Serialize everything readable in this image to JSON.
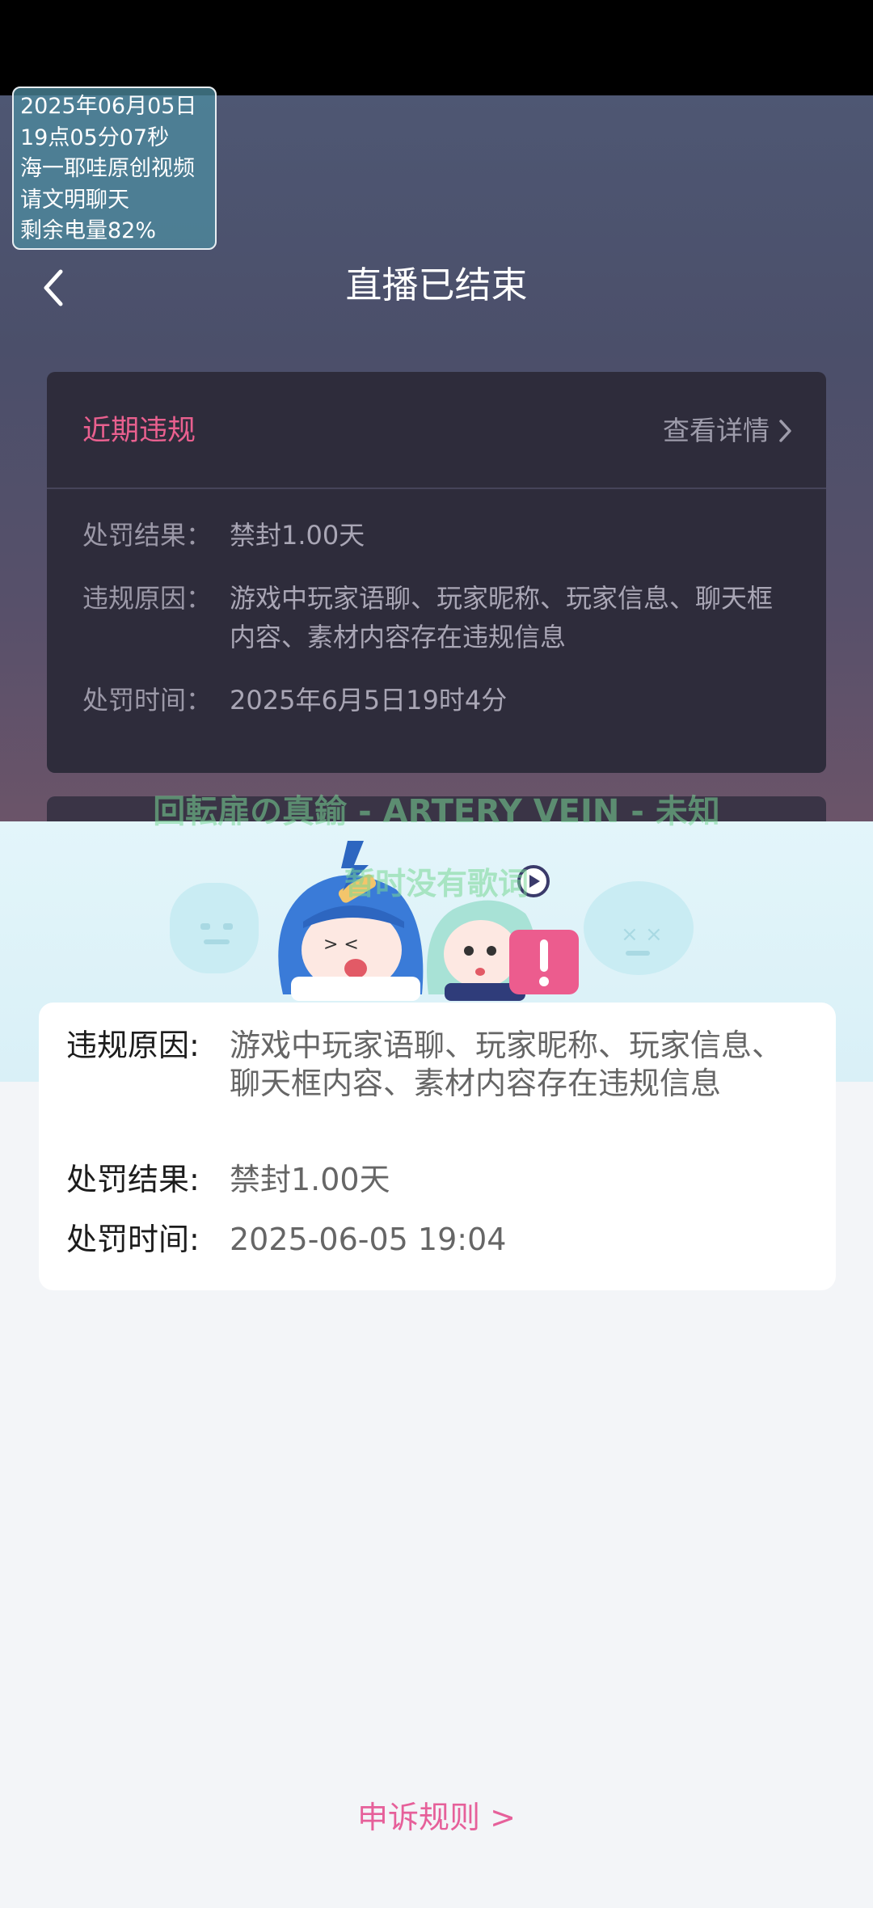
{
  "overlay": {
    "date": "2025年06月05日",
    "time": "19点05分07秒",
    "source": "海一耶哇原创视频",
    "notice": "请文明聊天",
    "battery": "剩余电量82%"
  },
  "header": {
    "title": "直播已结束"
  },
  "violation_card": {
    "title": "近期违规",
    "detail_link": "查看详情",
    "penalty_result_label": "处罚结果：",
    "penalty_result": "禁封1.00天",
    "reason_label": "违规原因：",
    "reason": "游戏中玩家语聊、玩家昵称、玩家信息、聊天框内容、素材内容存在违规信息",
    "time_label": "处罚时间：",
    "time": "2025年6月5日19时4分"
  },
  "song": {
    "line1": "回転扉の真鍮 - ARTERY VEIN - 未知",
    "line2": "暂时没有歌词"
  },
  "detail_card": {
    "reason_label": "违规原因:",
    "reason": "游戏中玩家语聊、玩家昵称、玩家信息、聊天框内容、素材内容存在违规信息",
    "result_label": "处罚结果:",
    "result": "禁封1.00天",
    "time_label": "处罚时间:",
    "time": "2025-06-05 19:04"
  },
  "footer": {
    "appeal_link": "申诉规则 >"
  },
  "colors": {
    "accent_pink": "#e6609a",
    "card_dark": "#2e2c3b",
    "sheet_bg": "#f3f5f8"
  }
}
